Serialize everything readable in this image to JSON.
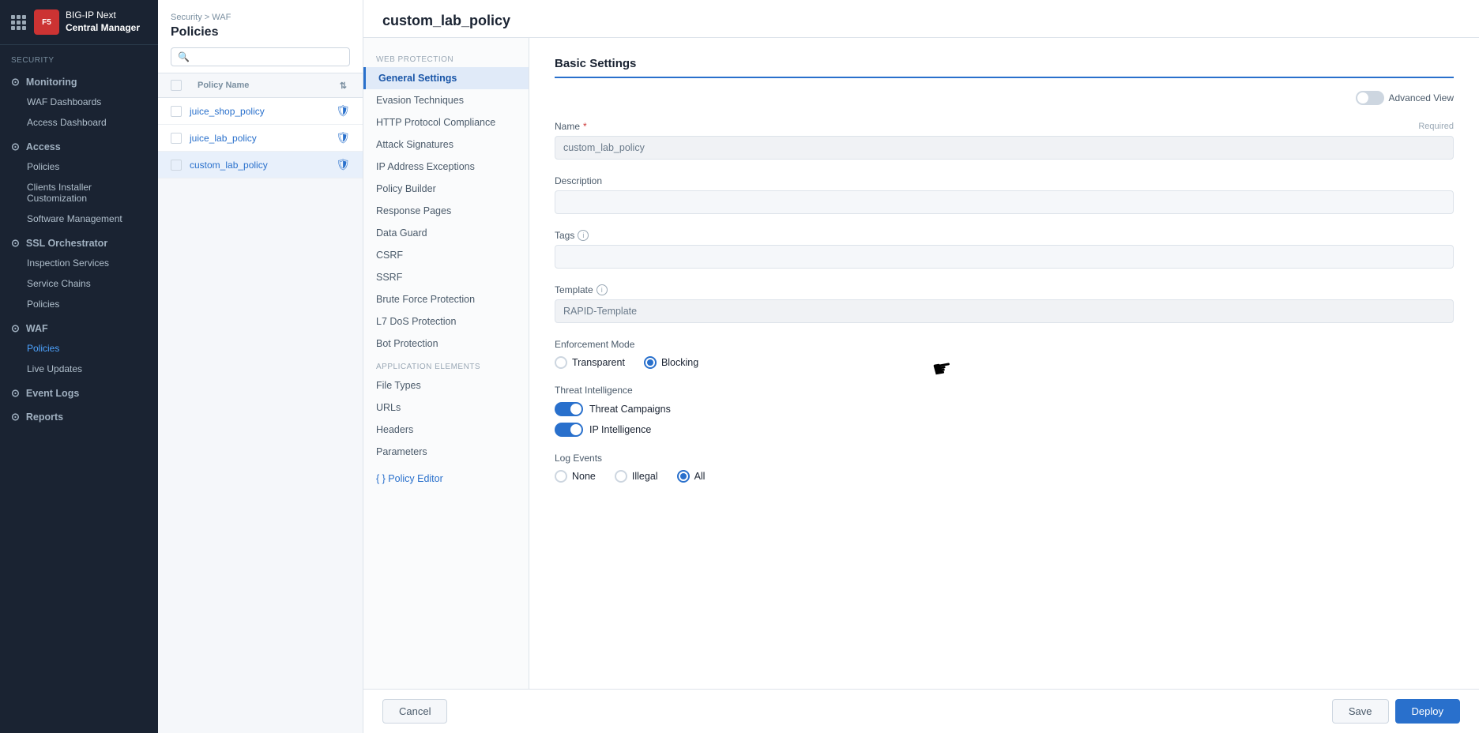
{
  "app": {
    "title": "BIG-IP Next Central Manager",
    "logo_text": "F5"
  },
  "sidebar": {
    "section_label": "Security",
    "groups": [
      {
        "label": "Monitoring",
        "icon": "●",
        "items": [
          "WAF Dashboards",
          "Access Dashboard"
        ]
      },
      {
        "label": "Access",
        "icon": "●",
        "items": [
          "Policies",
          "Clients Installer Customization",
          "Software Management"
        ]
      },
      {
        "label": "SSL Orchestrator",
        "icon": "●",
        "items": [
          "Inspection Services",
          "Service Chains",
          "Policies"
        ]
      },
      {
        "label": "WAF",
        "icon": "●",
        "items": [
          "Policies",
          "Live Updates"
        ]
      },
      {
        "label": "Event Logs",
        "icon": "●",
        "items": []
      },
      {
        "label": "Reports",
        "icon": "●",
        "items": []
      }
    ]
  },
  "policy_list": {
    "breadcrumb": "Security > WAF",
    "title": "Policies",
    "search_placeholder": "",
    "table_header": "Policy Name",
    "policies": [
      {
        "name": "juice_shop_policy",
        "has_icon": true
      },
      {
        "name": "juice_lab_policy",
        "has_icon": true
      },
      {
        "name": "custom_lab_policy",
        "has_icon": true
      }
    ]
  },
  "editor": {
    "title": "custom_lab_policy",
    "nav": {
      "web_protection_label": "WEB PROTECTION",
      "web_protection_items": [
        "General Settings",
        "Evasion Techniques",
        "HTTP Protocol Compliance",
        "Attack Signatures",
        "IP Address Exceptions",
        "Policy Builder",
        "Response Pages",
        "Data Guard",
        "CSRF",
        "SSRF",
        "Brute Force Protection",
        "L7 DoS Protection",
        "Bot Protection"
      ],
      "app_elements_label": "APPLICATION ELEMENTS",
      "app_elements_items": [
        "File Types",
        "URLs",
        "Headers",
        "Parameters"
      ],
      "policy_editor_label": "{ } Policy Editor"
    },
    "form": {
      "section_title": "Basic Settings",
      "advanced_view_label": "Advanced View",
      "name_label": "Name",
      "name_required": "Required",
      "name_value": "custom_lab_policy",
      "description_label": "Description",
      "description_value": "",
      "tags_label": "Tags",
      "tags_value": "",
      "template_label": "Template",
      "template_value": "RAPID-Template",
      "enforcement_mode_label": "Enforcement Mode",
      "enforcement_options": [
        "Transparent",
        "Blocking"
      ],
      "enforcement_selected": "Blocking",
      "threat_intel_label": "Threat Intelligence",
      "threat_campaigns_label": "Threat Campaigns",
      "threat_campaigns_on": true,
      "ip_intelligence_label": "IP Intelligence",
      "ip_intelligence_on": true,
      "log_events_label": "Log Events",
      "log_options": [
        "None",
        "Illegal",
        "All"
      ],
      "log_selected": "All"
    },
    "footer": {
      "cancel_label": "Cancel",
      "save_label": "Save",
      "deploy_label": "Deploy"
    }
  }
}
